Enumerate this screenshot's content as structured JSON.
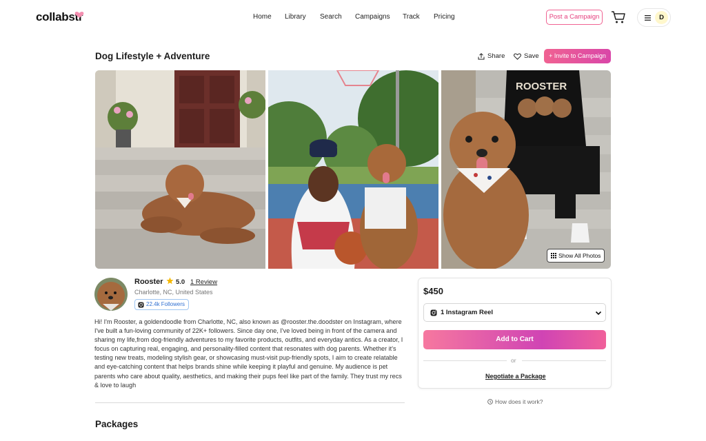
{
  "nav": {
    "logo": "collabstr",
    "links": [
      "Home",
      "Library",
      "Search",
      "Campaigns",
      "Track",
      "Pricing"
    ],
    "post_campaign": "Post a Campaign",
    "avatar_initial": "D"
  },
  "listing": {
    "title": "Dog Lifestyle + Adventure",
    "share": "Share",
    "save": "Save",
    "invite": "+ Invite to Campaign",
    "show_all_photos": "Show All Photos"
  },
  "creator": {
    "name": "Rooster",
    "rating": "5.0",
    "review": "1 Review",
    "location": "Charlotte, NC, United States",
    "followers": "22.4k Followers",
    "bio": "Hi! I'm Rooster, a goldendoodle from Charlotte, NC, also known as @rooster.the.doodster on Instagram, where I've built a fun-loving community of 22K+ followers. Since day one, I've loved being in front of the camera and sharing my life,from dog-friendly adventures to my favorite products, outfits, and everyday antics. As a creator, I focus on capturing real, engaging, and personality-filled content that resonates with dog parents. Whether it's testing new treats, modeling stylish gear, or showcasing must-visit pup-friendly spots, I aim to create relatable and eye-catching content that helps brands shine while keeping it playful and genuine. My audience is pet parents who care about quality, aesthetics, and making their pups feel like part of the family. They trust my recs & love to laugh"
  },
  "packages": {
    "title": "Packages"
  },
  "price_card": {
    "price": "$450",
    "selected_package": "1 Instagram Reel",
    "add_to_cart": "Add to Cart",
    "or": "or",
    "negotiate": "Negotiate a Package",
    "how_it_works": "How does it work?"
  },
  "colors": {
    "accent": "#e5407e",
    "gradient_start": "#f6789f",
    "gradient_mid": "#d044b4",
    "followers_blue": "#2f6fd1",
    "star": "#f5b800"
  },
  "icons": [
    "heart-logo-icon",
    "cart-icon",
    "menu-icon",
    "share-icon",
    "heart-icon",
    "grid-icon",
    "star-icon",
    "instagram-icon",
    "chevron-down-icon",
    "info-icon"
  ]
}
